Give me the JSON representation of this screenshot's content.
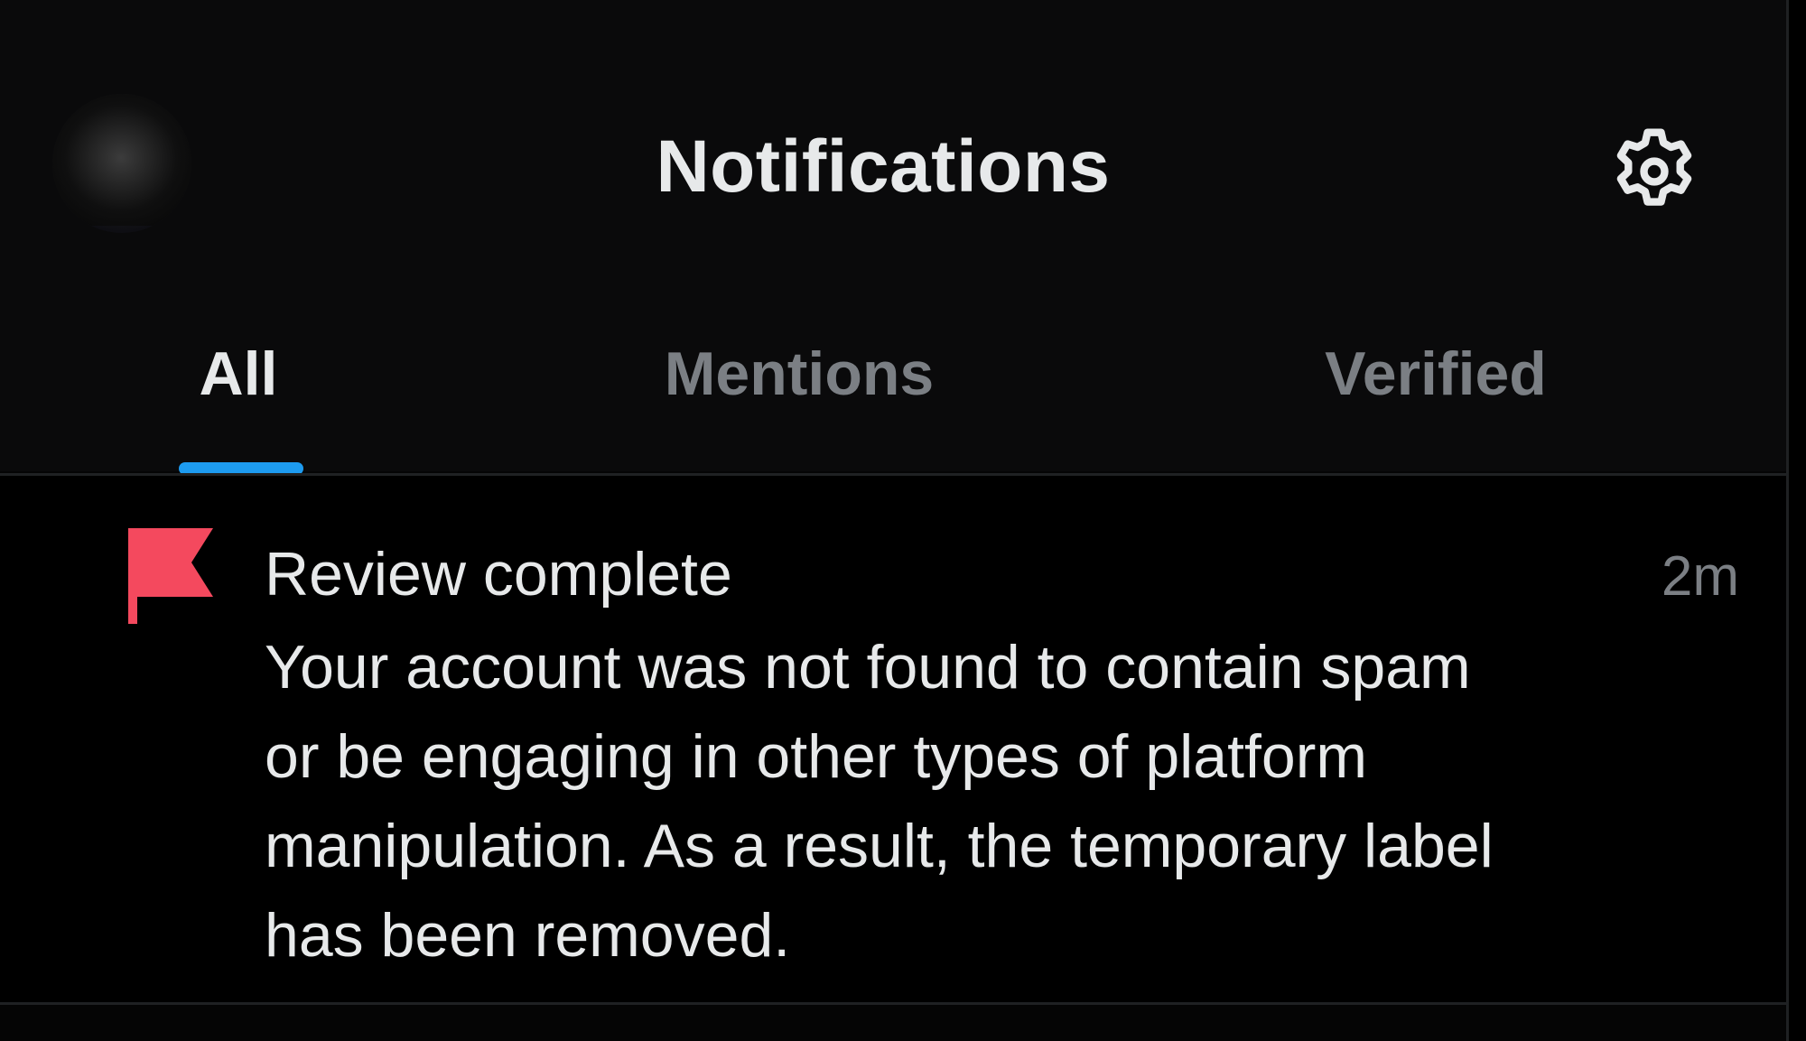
{
  "header": {
    "title": "Notifications",
    "avatar_icon": "avatar-blurred",
    "settings_icon": "gear-icon"
  },
  "tabs": [
    {
      "label": "All",
      "selected": true
    },
    {
      "label": "Mentions",
      "selected": false
    },
    {
      "label": "Verified",
      "selected": false
    }
  ],
  "notification": {
    "icon": "flag-icon",
    "title": "Review complete",
    "body": "Your account was not found to contain spam or be engaging in other types of platform manipulation. As a result, the temporary label has been removed.",
    "time": "2m"
  },
  "colors": {
    "accent": "#1d9bf0",
    "flag": "#f4495e",
    "text_primary": "#e7e9ea",
    "text_secondary": "#7b7f84",
    "background": "#000000"
  }
}
